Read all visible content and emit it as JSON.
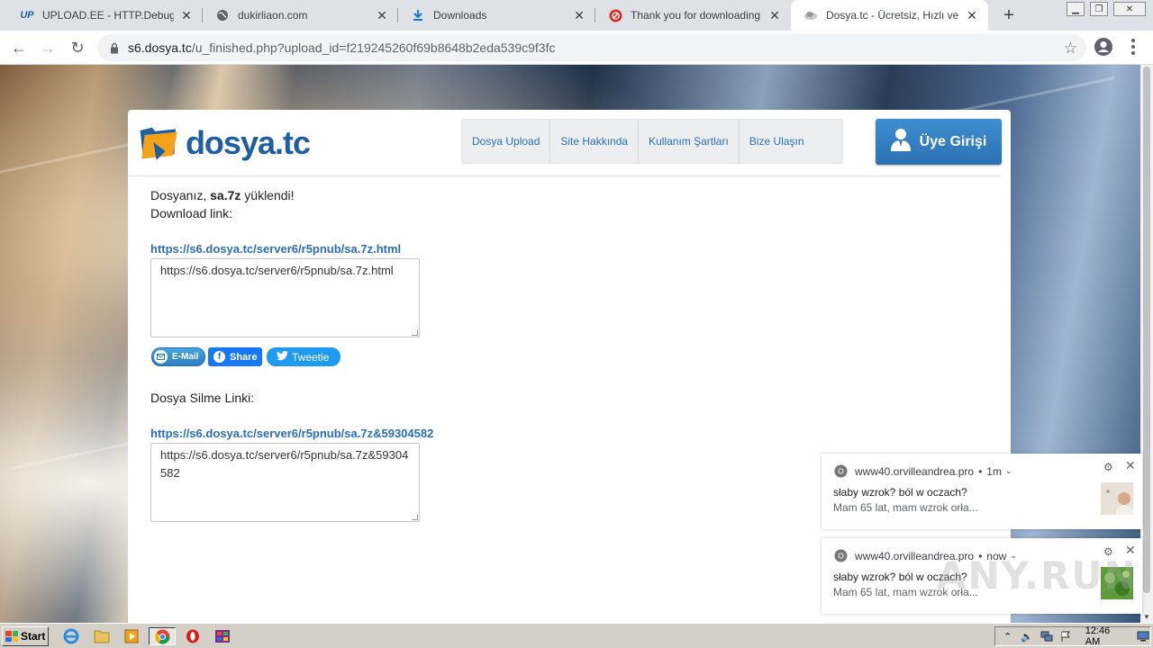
{
  "browser": {
    "tabs": [
      {
        "title": "UPLOAD.EE - HTTP.Debugger.Pro",
        "favicon": "upload-ee-icon",
        "active": false
      },
      {
        "title": "dukirliaon.com",
        "favicon": "globe-icon",
        "active": false
      },
      {
        "title": "Downloads",
        "favicon": "download-icon",
        "active": false
      },
      {
        "title": "Thank you for downloading HTTP",
        "favicon": "blocked-icon",
        "active": false
      },
      {
        "title": "Dosya.tc - Ücretsiz, Hızlı ve Kolay",
        "favicon": "dosya-icon",
        "active": true
      }
    ],
    "url_host": "s6.dosya.tc",
    "url_path": "/u_finished.php?upload_id=f219245260f69b8648b2eda539c9f3fc",
    "controls": {
      "new_tab": "+",
      "back": "←",
      "forward": "→",
      "reload": "↻",
      "star": "☆"
    }
  },
  "site": {
    "logo_brand": "dosya",
    "logo_tld": ".tc",
    "nav": [
      "Dosya Upload",
      "Site Hakkında",
      "Kullanım Şartları",
      "Bize Ulaşın"
    ],
    "login_label": "Üye Girişi",
    "upload_msg_prefix": "Dosyanız, ",
    "file_name": "sa.7z",
    "upload_msg_suffix": " yüklendi!",
    "download_label": "Download link:",
    "download_link": "https://s6.dosya.tc/server6/r5pnub/sa.7z.html",
    "download_box": "https://s6.dosya.tc/server6/r5pnub/sa.7z.html",
    "share": {
      "email": "E-Mail",
      "facebook": "Share",
      "twitter": "Tweetle"
    },
    "delete_label": "Dosya Silme Linki:",
    "delete_link": "https://s6.dosya.tc/server6/r5pnub/sa.7z&59304582",
    "delete_box": "https://s6.dosya.tc/server6/r5pnub/sa.7z&59304582"
  },
  "notifications": [
    {
      "source": "www40.orvilleandrea.pro",
      "time": "1m",
      "title": "słaby wzrok? ból w oczach?",
      "body": "Mam 65 lat, mam wzrok orła..."
    },
    {
      "source": "www40.orvilleandrea.pro",
      "time": "now",
      "title": "słaby wzrok? ból w oczach?",
      "body": "Mam 65 lat, mam wzrok orła..."
    }
  ],
  "watermark": "ANY.RUN",
  "taskbar": {
    "start_label": "Start",
    "clock": "12:46 AM"
  },
  "colors": {
    "accent": "#2a6fb5",
    "login_button": "#3a86c8",
    "facebook": "#1877f2",
    "twitter": "#1d9bf0"
  }
}
